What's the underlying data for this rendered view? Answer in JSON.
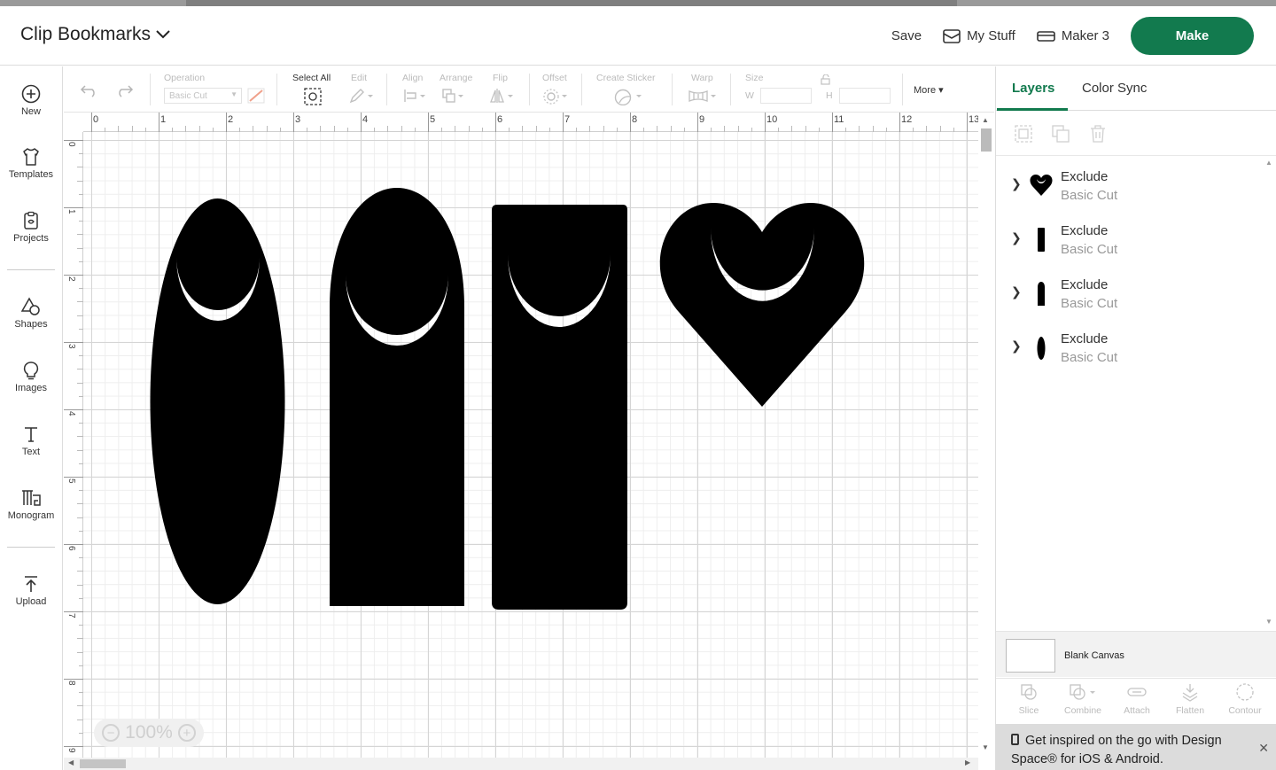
{
  "header": {
    "project_title": "Clip Bookmarks",
    "save_label": "Save",
    "mystuff_label": "My Stuff",
    "machine_label": "Maker 3",
    "make_label": "Make"
  },
  "leftbar": {
    "items": [
      {
        "label": "New",
        "icon": "plus-circle-icon"
      },
      {
        "label": "Templates",
        "icon": "shirt-icon"
      },
      {
        "label": "Projects",
        "icon": "clipboard-icon"
      },
      {
        "label": "Shapes",
        "icon": "shapes-icon"
      },
      {
        "label": "Images",
        "icon": "lightbulb-icon"
      },
      {
        "label": "Text",
        "icon": "text-icon"
      },
      {
        "label": "Monogram",
        "icon": "monogram-icon"
      },
      {
        "label": "Upload",
        "icon": "upload-icon"
      }
    ]
  },
  "toolbar": {
    "operation_label": "Operation",
    "operation_value": "Basic Cut",
    "select_all_label": "Select All",
    "edit_label": "Edit",
    "align_label": "Align",
    "arrange_label": "Arrange",
    "flip_label": "Flip",
    "offset_label": "Offset",
    "create_sticker_label": "Create Sticker",
    "warp_label": "Warp",
    "size_label": "Size",
    "w_label": "W",
    "h_label": "H",
    "more_label": "More"
  },
  "canvas": {
    "ruler_top": [
      "0",
      "1",
      "2",
      "3",
      "4",
      "5",
      "6",
      "7",
      "8",
      "9",
      "10",
      "11",
      "12",
      "13"
    ],
    "ruler_left": [
      "0",
      "1",
      "2",
      "3",
      "4",
      "5",
      "6",
      "7",
      "8",
      "9"
    ],
    "zoom_label": "100%"
  },
  "right_panel": {
    "tabs": [
      "Layers",
      "Color Sync"
    ],
    "layers": [
      {
        "name": "Exclude",
        "operation": "Basic Cut",
        "thumb": "heart"
      },
      {
        "name": "Exclude",
        "operation": "Basic Cut",
        "thumb": "rectangle"
      },
      {
        "name": "Exclude",
        "operation": "Basic Cut",
        "thumb": "rounded-top"
      },
      {
        "name": "Exclude",
        "operation": "Basic Cut",
        "thumb": "oval"
      }
    ],
    "blank_canvas_label": "Blank Canvas",
    "actions": [
      "Slice",
      "Combine",
      "Attach",
      "Flatten",
      "Contour"
    ],
    "banner_text": "Get inspired on the go with Design Space® for iOS & Android."
  },
  "colors": {
    "accent": "#127a4e",
    "shape_fill": "#000000"
  }
}
